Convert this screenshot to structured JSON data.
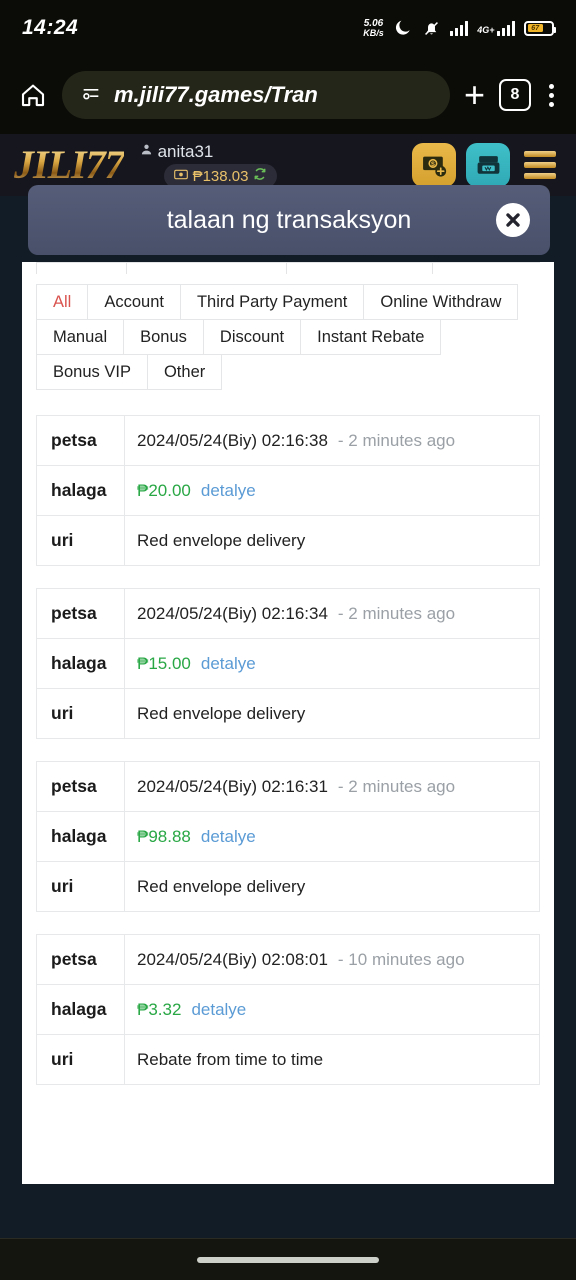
{
  "status_bar": {
    "time": "14:24",
    "network_speed_value": "5.06",
    "network_speed_unit": "KB/s",
    "icons": [
      "moon-icon",
      "bell-muted-icon",
      "signal-bars-icon",
      "4g-plus-icon",
      "battery-icon"
    ],
    "network_type": "4G+",
    "battery_percent": "67"
  },
  "browser": {
    "home_icon": "home-icon",
    "page_info_icon": "page-info-icon",
    "url": "m.jili77.games/Tran",
    "new_tab_icon": "plus-icon",
    "tab_count": "8",
    "menu_icon": "kebab-menu-icon"
  },
  "site_header": {
    "logo_text": "JILI77",
    "username": "anita31",
    "user_icon": "person-icon",
    "wallet_icon": "wallet-icon",
    "balance": "₱138.03",
    "refresh_icon": "refresh-icon",
    "deposit_label": "deposit",
    "deposit_icon": "money-deposit-icon",
    "withdraw_label": "withdraw",
    "withdraw_icon": "atm-withdraw-icon",
    "menu_label": "menu",
    "hamburger_icon": "hamburger-icon",
    "logo_gold": "#d9a642",
    "deposit_color": "#e9b949",
    "withdraw_color": "#3fc0c9"
  },
  "toast": {
    "message": "talaan ng transaksyon",
    "close_icon": "close-icon",
    "background": "#49506a"
  },
  "filters": {
    "items": [
      {
        "label": "All",
        "active": true
      },
      {
        "label": "Account",
        "active": false
      },
      {
        "label": "Third Party Payment",
        "active": false
      },
      {
        "label": "Online Withdraw",
        "active": false
      },
      {
        "label": "Manual",
        "active": false
      },
      {
        "label": "Bonus",
        "active": false
      },
      {
        "label": "Discount",
        "active": false
      },
      {
        "label": "Instant Rebate",
        "active": false
      },
      {
        "label": "Bonus VIP",
        "active": false
      },
      {
        "label": "Other",
        "active": false
      }
    ],
    "active_color": "#d9534f"
  },
  "table": {
    "key_date": "petsa",
    "key_amount": "halaga",
    "key_type": "uri",
    "detail_link": "detalye",
    "amount_color": "#29a745",
    "link_color": "#5b9bd5",
    "transactions": [
      {
        "date": "2024/05/24(Biy) 02:16:38",
        "ago": "- 2 minutes ago",
        "amount": "₱20.00",
        "detail": "detalye",
        "type": "Red envelope delivery"
      },
      {
        "date": "2024/05/24(Biy) 02:16:34",
        "ago": "- 2 minutes ago",
        "amount": "₱15.00",
        "detail": "detalye",
        "type": "Red envelope delivery"
      },
      {
        "date": "2024/05/24(Biy) 02:16:31",
        "ago": "- 2 minutes ago",
        "amount": "₱98.88",
        "detail": "detalye",
        "type": "Red envelope delivery"
      },
      {
        "date": "2024/05/24(Biy) 02:08:01",
        "ago": "- 10 minutes ago",
        "amount": "₱3.32",
        "detail": "detalye",
        "type": "Rebate from time to time"
      }
    ]
  },
  "nav_bar": {
    "gesture_pill": "home-gesture-pill"
  }
}
